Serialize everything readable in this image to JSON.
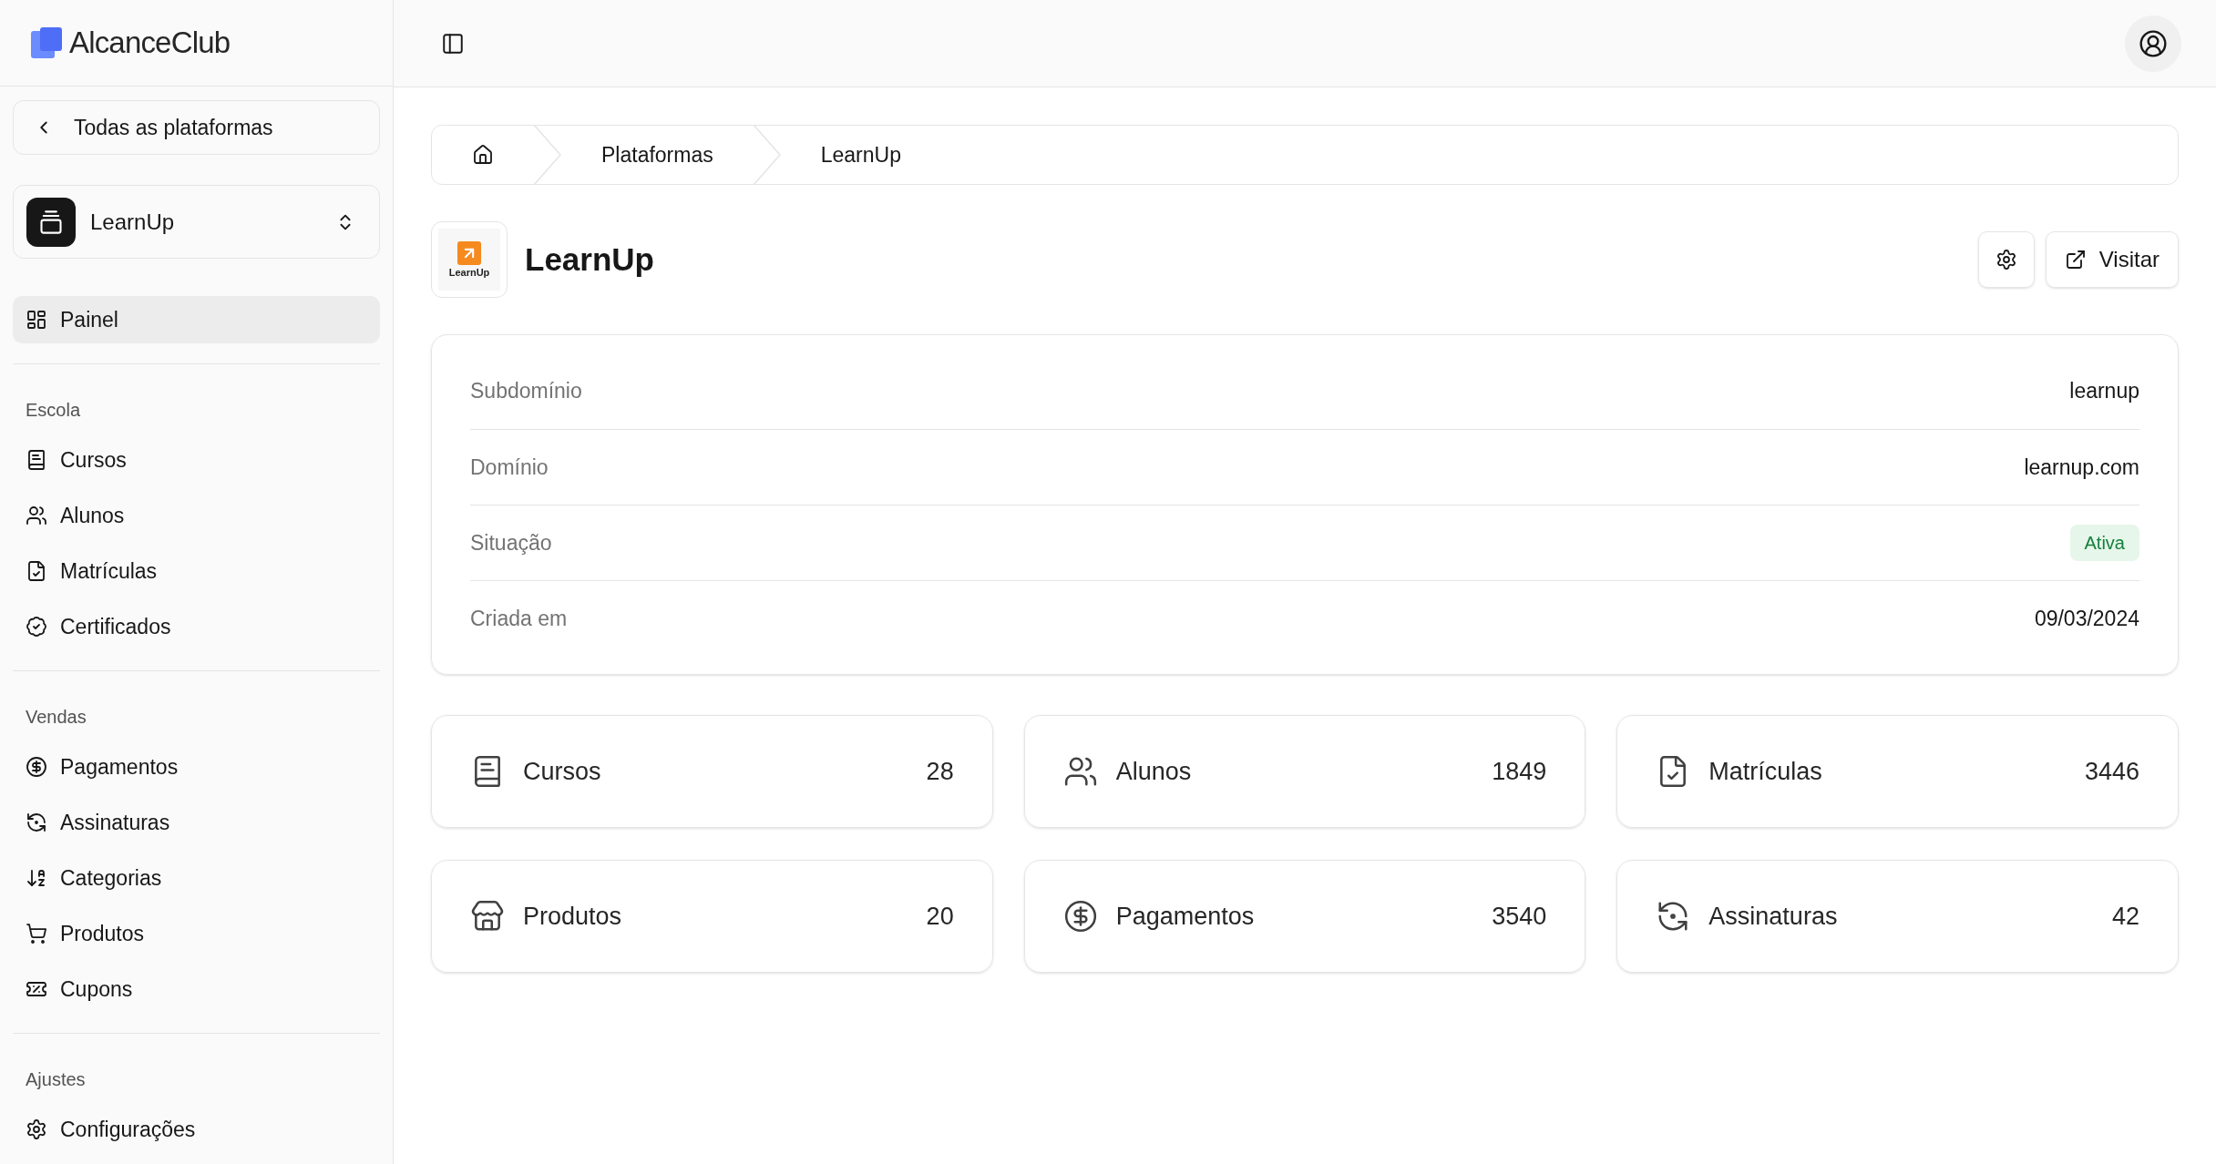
{
  "brand": {
    "name": "AlcanceClub"
  },
  "sidebar": {
    "back_button": "Todas as plataformas",
    "platform_select": {
      "value": "LearnUp"
    },
    "top_items": [
      {
        "label": "Painel",
        "selected": true
      }
    ],
    "sections": [
      {
        "title": "Escola",
        "items": [
          {
            "label": "Cursos",
            "selected": false
          },
          {
            "label": "Alunos",
            "selected": false
          },
          {
            "label": "Matrículas",
            "selected": false
          },
          {
            "label": "Certificados",
            "selected": false
          }
        ]
      },
      {
        "title": "Vendas",
        "items": [
          {
            "label": "Pagamentos",
            "selected": false
          },
          {
            "label": "Assinaturas",
            "selected": false
          },
          {
            "label": "Categorias",
            "selected": false
          },
          {
            "label": "Produtos",
            "selected": false
          },
          {
            "label": "Cupons",
            "selected": false
          }
        ]
      },
      {
        "title": "Ajustes",
        "items": [
          {
            "label": "Configurações",
            "selected": false
          }
        ]
      }
    ]
  },
  "breadcrumb": [
    {
      "label": "Plataformas"
    },
    {
      "label": "LearnUp"
    }
  ],
  "platform": {
    "logo_text": "LearnUp",
    "title": "LearnUp",
    "visit_button": "Visitar"
  },
  "details": [
    {
      "label": "Subdomínio",
      "value": "learnup",
      "kind": "text"
    },
    {
      "label": "Domínio",
      "value": "learnup.com",
      "kind": "text"
    },
    {
      "label": "Situação",
      "value": "Ativa",
      "kind": "badge"
    },
    {
      "label": "Criada em",
      "value": "09/03/2024",
      "kind": "text"
    }
  ],
  "stats": [
    {
      "label": "Cursos",
      "value": "28"
    },
    {
      "label": "Alunos",
      "value": "1849"
    },
    {
      "label": "Matrículas",
      "value": "3446"
    },
    {
      "label": "Produtos",
      "value": "20"
    },
    {
      "label": "Pagamentos",
      "value": "3540"
    },
    {
      "label": "Assinaturas",
      "value": "42"
    }
  ]
}
